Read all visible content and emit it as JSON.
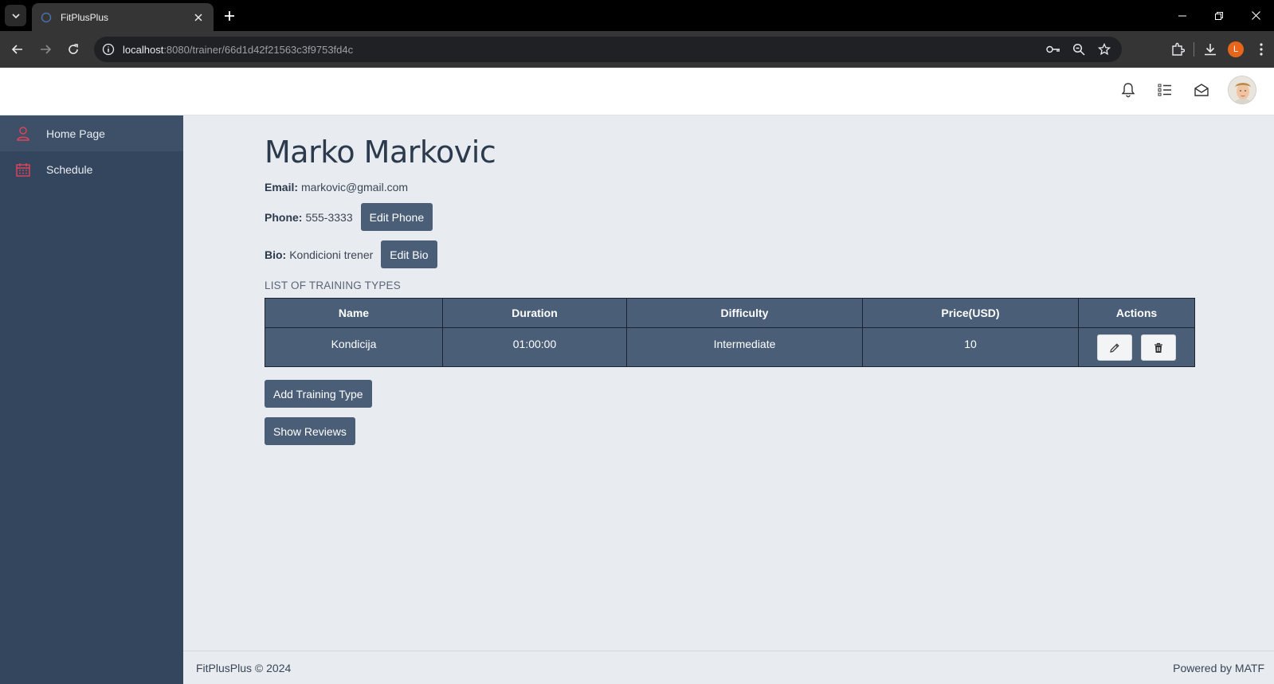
{
  "browser": {
    "tab_title": "FitPlusPlus",
    "url_host": "localhost",
    "url_rest": ":8080/trainer/66d1d42f21563c3f9753fd4c",
    "profile_initial": "L"
  },
  "sidebar": {
    "items": [
      {
        "label": "Home Page",
        "icon": "user-icon"
      },
      {
        "label": "Schedule",
        "icon": "calendar-icon"
      }
    ]
  },
  "trainer": {
    "name": "Marko Markovic",
    "email_label": "Email:",
    "email": "markovic@gmail.com",
    "phone_label": "Phone:",
    "phone": "555-3333",
    "edit_phone": "Edit Phone",
    "bio_label": "Bio:",
    "bio": "Kondicioni trener",
    "edit_bio": "Edit Bio"
  },
  "training_types": {
    "section_title": "LIST OF TRAINING TYPES",
    "columns": [
      "Name",
      "Duration",
      "Difficulty",
      "Price(USD)",
      "Actions"
    ],
    "rows": [
      {
        "name": "Kondicija",
        "duration": "01:00:00",
        "difficulty": "Intermediate",
        "price": "10"
      }
    ]
  },
  "buttons": {
    "add_training_type": "Add Training Type",
    "show_reviews": "Show Reviews"
  },
  "footer": {
    "left": "FitPlusPlus © 2024",
    "right": "Powered by MATF"
  }
}
